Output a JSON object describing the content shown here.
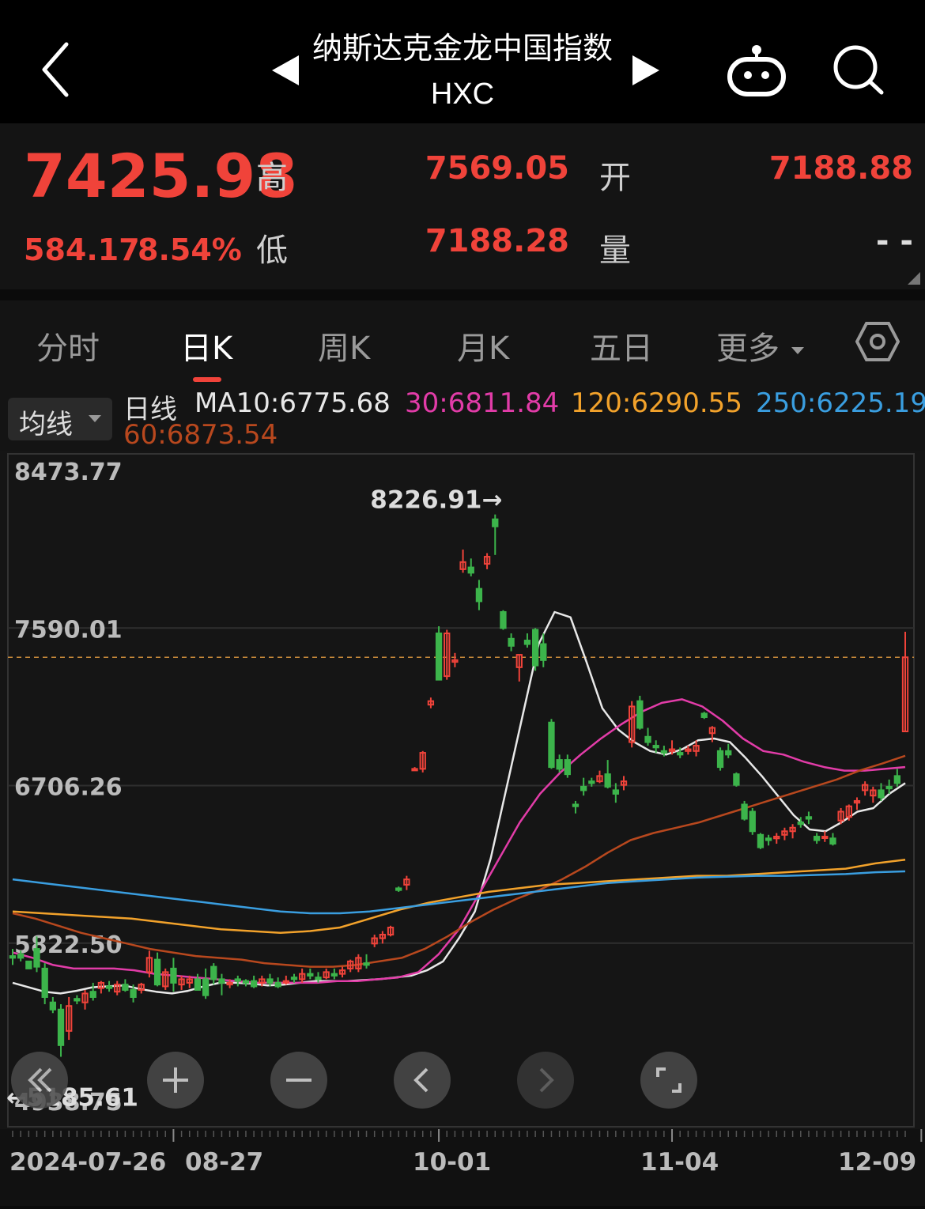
{
  "header": {
    "title": "纳斯达克金龙中国指数",
    "symbol": "HXC"
  },
  "quote": {
    "price": "7425.98",
    "change": "584.17",
    "change_pct": "8.54%",
    "high_label": "高",
    "high": "7569.05",
    "open_label": "开",
    "open": "7188.88",
    "low_label": "低",
    "low": "7188.28",
    "volume_label": "量",
    "volume": "- -"
  },
  "tabs": [
    "分时",
    "日K",
    "周K",
    "月K",
    "五日",
    "更多"
  ],
  "active_tab": "日K",
  "legend": {
    "dropdown": "均线",
    "period": "日线",
    "ma10": "MA10:6775.68",
    "ma30": "30:6811.84",
    "ma120": "120:6290.55",
    "ma250": "250:6225.19",
    "ma60": "60:6873.54"
  },
  "colors": {
    "up": "#f0433a",
    "down": "#3cb44b",
    "ma10": "#e8e8e8",
    "ma30": "#e23ca8",
    "ma60": "#b8481e",
    "ma120": "#f2a22b",
    "ma250": "#3a9ee0"
  },
  "controls": [
    "rewind-icon",
    "zoom-in-icon",
    "zoom-out-icon",
    "left-icon",
    "right-icon",
    "fullscreen-icon"
  ],
  "chart_data": {
    "type": "candlestick",
    "y_ticks": [
      "8473.77",
      "7590.01",
      "6706.26",
      "5822.50",
      "4938.75"
    ],
    "ylim": [
      4938.75,
      8473.77
    ],
    "x_ticks": [
      "2024-07-26",
      "08-27",
      "10-01",
      "11-04",
      "12-09"
    ],
    "reference_line": 7425.98,
    "max_label": "8226.91→",
    "max_value": 8226.91,
    "min_label": "←5185.61",
    "min_value": 5185.61,
    "candles": [
      [
        5750,
        5790,
        5700,
        5740
      ],
      [
        5760,
        5780,
        5720,
        5740
      ],
      [
        5720,
        5710,
        5680,
        5680
      ],
      [
        5790,
        5860,
        5660,
        5690
      ],
      [
        5680,
        5710,
        5480,
        5520
      ],
      [
        5490,
        5520,
        5430,
        5450
      ],
      [
        5450,
        5480,
        5185,
        5250
      ],
      [
        5330,
        5520,
        5280,
        5470
      ],
      [
        5510,
        5530,
        5480,
        5500
      ],
      [
        5490,
        5560,
        5450,
        5540
      ],
      [
        5550,
        5600,
        5500,
        5520
      ],
      [
        5570,
        5610,
        5540,
        5600
      ],
      [
        5580,
        5610,
        5550,
        5570
      ],
      [
        5550,
        5610,
        5530,
        5590
      ],
      [
        5590,
        5620,
        5550,
        5560
      ],
      [
        5560,
        5590,
        5490,
        5520
      ],
      [
        5560,
        5600,
        5540,
        5590
      ],
      [
        5660,
        5780,
        5630,
        5740
      ],
      [
        5730,
        5770,
        5580,
        5590
      ],
      [
        5580,
        5680,
        5560,
        5660
      ],
      [
        5680,
        5740,
        5550,
        5600
      ],
      [
        5590,
        5640,
        5560,
        5620
      ],
      [
        5600,
        5640,
        5570,
        5620
      ],
      [
        5620,
        5650,
        5560,
        5560
      ],
      [
        5620,
        5680,
        5510,
        5530
      ],
      [
        5690,
        5710,
        5590,
        5620
      ],
      [
        5620,
        5650,
        5530,
        5600
      ],
      [
        5590,
        5620,
        5570,
        5600
      ],
      [
        5620,
        5640,
        5580,
        5610
      ],
      [
        5610,
        5620,
        5580,
        5600
      ],
      [
        5610,
        5640,
        5570,
        5580
      ],
      [
        5600,
        5640,
        5580,
        5620
      ],
      [
        5620,
        5650,
        5580,
        5600
      ],
      [
        5600,
        5630,
        5570,
        5580
      ],
      [
        5600,
        5640,
        5590,
        5610
      ],
      [
        5630,
        5650,
        5600,
        5620
      ],
      [
        5620,
        5680,
        5600,
        5650
      ],
      [
        5650,
        5680,
        5620,
        5640
      ],
      [
        5630,
        5660,
        5600,
        5620
      ],
      [
        5630,
        5680,
        5620,
        5660
      ],
      [
        5650,
        5680,
        5620,
        5640
      ],
      [
        5650,
        5690,
        5630,
        5670
      ],
      [
        5680,
        5730,
        5660,
        5720
      ],
      [
        5680,
        5760,
        5660,
        5740
      ],
      [
        5710,
        5760,
        5680,
        5700
      ],
      [
        5820,
        5870,
        5800,
        5850
      ],
      [
        5850,
        5890,
        5820,
        5870
      ],
      [
        5870,
        5920,
        5860,
        5910
      ],
      [
        6130,
        6140,
        6110,
        6120
      ],
      [
        6150,
        6200,
        6120,
        6180
      ],
      [
        6800,
        6810,
        6790,
        6800
      ],
      [
        6800,
        6900,
        6780,
        6890
      ],
      [
        7160,
        7200,
        7140,
        7180
      ],
      [
        7560,
        7600,
        7300,
        7300
      ],
      [
        7320,
        7580,
        7300,
        7560
      ],
      [
        7400,
        7450,
        7370,
        7410
      ],
      [
        7920,
        8030,
        7900,
        7960
      ],
      [
        7930,
        7980,
        7880,
        7900
      ],
      [
        7810,
        7860,
        7690,
        7740
      ],
      [
        7950,
        8010,
        7920,
        7990
      ],
      [
        8200,
        8226.91,
        8000,
        8160
      ],
      [
        7680,
        7690,
        7580,
        7590
      ],
      [
        7530,
        7560,
        7460,
        7490
      ],
      [
        7370,
        7440,
        7290,
        7440
      ],
      [
        7520,
        7560,
        7480,
        7500
      ],
      [
        7580,
        7590,
        7350,
        7380
      ],
      [
        7500,
        7560,
        7370,
        7410
      ],
      [
        7060,
        7080,
        6800,
        6810
      ],
      [
        6850,
        6880,
        6780,
        6800
      ],
      [
        6850,
        6880,
        6750,
        6770
      ],
      [
        6600,
        6620,
        6550,
        6590
      ],
      [
        6700,
        6750,
        6650,
        6680
      ],
      [
        6730,
        6750,
        6700,
        6720
      ],
      [
        6730,
        6790,
        6720,
        6760
      ],
      [
        6770,
        6850,
        6690,
        6700
      ],
      [
        6680,
        6720,
        6610,
        6660
      ],
      [
        6710,
        6760,
        6680,
        6730
      ],
      [
        6950,
        7180,
        6920,
        7150
      ],
      [
        7180,
        7210,
        7020,
        7030
      ],
      [
        6980,
        7030,
        6930,
        6950
      ],
      [
        6930,
        6960,
        6890,
        6920
      ],
      [
        6900,
        6930,
        6870,
        6890
      ],
      [
        6900,
        6960,
        6880,
        6910
      ],
      [
        6890,
        6920,
        6860,
        6880
      ],
      [
        6900,
        6930,
        6880,
        6910
      ],
      [
        6900,
        6960,
        6870,
        6930
      ],
      [
        7110,
        7120,
        7080,
        7090
      ],
      [
        7000,
        7040,
        6950,
        7030
      ],
      [
        6900,
        6920,
        6790,
        6810
      ],
      [
        6900,
        6940,
        6860,
        6880
      ],
      [
        6770,
        6780,
        6700,
        6710
      ],
      [
        6600,
        6620,
        6510,
        6520
      ],
      [
        6560,
        6580,
        6430,
        6450
      ],
      [
        6430,
        6440,
        6350,
        6360
      ],
      [
        6410,
        6430,
        6370,
        6400
      ],
      [
        6410,
        6440,
        6380,
        6420
      ],
      [
        6430,
        6470,
        6400,
        6450
      ],
      [
        6450,
        6490,
        6410,
        6470
      ],
      [
        6500,
        6530,
        6470,
        6490
      ],
      [
        6530,
        6560,
        6490,
        6520
      ],
      [
        6420,
        6440,
        6380,
        6400
      ],
      [
        6420,
        6450,
        6390,
        6420
      ],
      [
        6410,
        6440,
        6370,
        6380
      ],
      [
        6510,
        6580,
        6490,
        6560
      ],
      [
        6530,
        6600,
        6510,
        6590
      ],
      [
        6610,
        6640,
        6570,
        6620
      ],
      [
        6680,
        6730,
        6650,
        6710
      ],
      [
        6650,
        6700,
        6610,
        6680
      ],
      [
        6680,
        6720,
        6620,
        6640
      ],
      [
        6700,
        6740,
        6660,
        6690
      ],
      [
        6760,
        6800,
        6700,
        6720
      ],
      [
        7010,
        7569.05,
        7010,
        7425.98
      ]
    ],
    "series": [
      {
        "name": "MA10",
        "values": [
          5600,
          5575,
          5550,
          5540,
          5555,
          5575,
          5580,
          5585,
          5565,
          5550,
          5540,
          5555,
          5580,
          5600,
          5600,
          5595,
          5585,
          5590,
          5600,
          5610,
          5610,
          5610,
          5615,
          5620,
          5630,
          5640,
          5670,
          5720,
          5850,
          6000,
          6300,
          6700,
          7100,
          7500,
          7680,
          7650,
          7400,
          7140,
          7020,
          6950,
          6900,
          6880,
          6910,
          6960,
          6970,
          6950,
          6860,
          6760,
          6650,
          6540,
          6460,
          6450,
          6500,
          6560,
          6580,
          6660,
          6720
        ]
      },
      {
        "name": "30",
        "values": [
          5770,
          5740,
          5700,
          5680,
          5680,
          5680,
          5670,
          5650,
          5640,
          5630,
          5620,
          5610,
          5600,
          5600,
          5600,
          5600,
          5610,
          5610,
          5620,
          5630,
          5660,
          5760,
          5900,
          6100,
          6300,
          6500,
          6660,
          6780,
          6880,
          6970,
          7050,
          7120,
          7170,
          7190,
          7150,
          7070,
          6970,
          6900,
          6880,
          6840,
          6810,
          6790,
          6790,
          6800,
          6810
        ]
      },
      {
        "name": "60",
        "values": [
          5990,
          5960,
          5920,
          5880,
          5850,
          5820,
          5790,
          5770,
          5750,
          5740,
          5730,
          5710,
          5700,
          5690,
          5690,
          5700,
          5720,
          5740,
          5790,
          5860,
          5940,
          6010,
          6070,
          6120,
          6180,
          6250,
          6330,
          6400,
          6440,
          6470,
          6500,
          6540,
          6580,
          6620,
          6660,
          6700,
          6740,
          6790,
          6830,
          6873.54
        ]
      },
      {
        "name": "120",
        "values": [
          6000,
          5990,
          5980,
          5970,
          5960,
          5940,
          5920,
          5900,
          5890,
          5880,
          5890,
          5910,
          5960,
          6010,
          6050,
          6080,
          6110,
          6130,
          6150,
          6160,
          6170,
          6180,
          6190,
          6200,
          6200,
          6210,
          6220,
          6230,
          6240,
          6270,
          6290.55
        ]
      },
      {
        "name": "250",
        "values": [
          6180,
          6160,
          6140,
          6120,
          6100,
          6080,
          6060,
          6040,
          6020,
          6000,
          5990,
          5990,
          6000,
          6020,
          6040,
          6060,
          6080,
          6100,
          6120,
          6140,
          6160,
          6170,
          6180,
          6190,
          6195,
          6200,
          6200,
          6205,
          6210,
          6220,
          6225.19
        ]
      }
    ]
  }
}
